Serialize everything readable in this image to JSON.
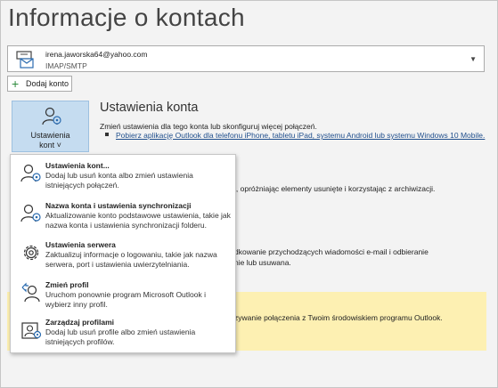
{
  "page": {
    "title": "Informacje o kontach"
  },
  "account": {
    "email": "irena.jaworska64@yahoo.com",
    "type": "IMAP/SMTP"
  },
  "add_account": {
    "label": "Dodaj konto"
  },
  "settings_tile": {
    "line1": "Ustawienia",
    "line2": "kont ˅"
  },
  "account_settings": {
    "heading": "Ustawienia konta",
    "description": "Zmień ustawienia dla tego konta lub skonfiguruj więcej połączeń.",
    "mobile_link": "Pobierz aplikację Outlook dla telefonu iPhone, tabletu iPad, systemu Android lub systemu Windows 10 Mobile."
  },
  "background_text": {
    "cleanup_line": "j, opróżniając elementy usunięte i korzystając z archiwizacji.",
    "rules_line1": "dkowanie przychodzących wiadomości e-mail i odbieranie",
    "rules_line2": "nie lub usuwana.",
    "banner_line": "zywanie połączenia z Twoim środowiskiem programu Outlook."
  },
  "menu": {
    "items": [
      {
        "title": "Ustawienia kont...",
        "desc": "Dodaj lub usuń konta albo zmień ustawienia istniejących połączeń.",
        "icon": "account-settings-icon"
      },
      {
        "title": "Nazwa konta i ustawienia synchronizacji",
        "desc": "Aktualizowanie konto podstawowe ustawienia, takie jak nazwa konta i ustawienia synchronizacji folderu.",
        "icon": "account-sync-icon"
      },
      {
        "title": "Ustawienia serwera",
        "desc": "Zaktualizuj informacje o logowaniu, takie jak nazwa serwera, port i ustawienia uwierzytelniania.",
        "icon": "gear-icon"
      },
      {
        "title": "Zmień profil",
        "desc": "Uruchom ponownie program Microsoft Outlook i wybierz inny profil.",
        "icon": "change-profile-icon"
      },
      {
        "title": "Zarządzaj profilami",
        "desc": "Dodaj lub usuń profile albo zmień ustawienia istniejących profilów.",
        "icon": "manage-profiles-icon"
      }
    ]
  }
}
